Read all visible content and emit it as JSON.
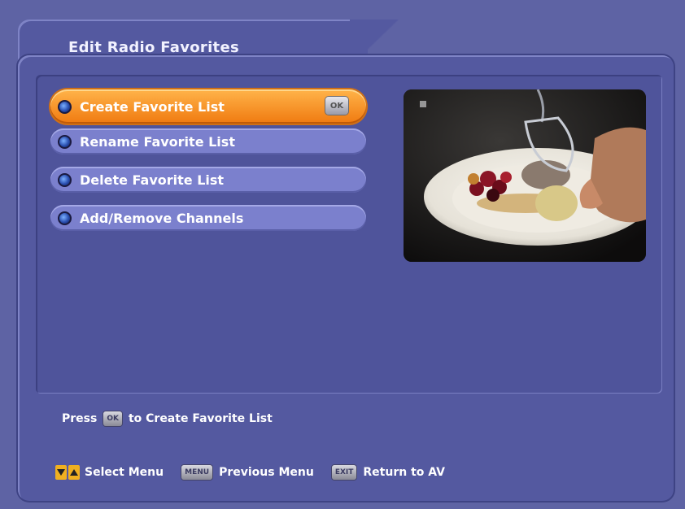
{
  "window": {
    "title": "Edit Radio Favorites"
  },
  "menu": {
    "items": [
      {
        "label": "Create Favorite List",
        "selected": true,
        "badge": "OK"
      },
      {
        "label": "Rename Favorite List",
        "selected": false
      },
      {
        "label": "Delete Favorite List",
        "selected": false
      },
      {
        "label": "Add/Remove Channels",
        "selected": false
      }
    ]
  },
  "hint": {
    "press": "Press",
    "key": "OK",
    "action": "to Create Favorite List"
  },
  "footer": {
    "select_label": "Select Menu",
    "menu_key": "MENU",
    "menu_label": "Previous Menu",
    "exit_key": "EXIT",
    "exit_label": "Return to AV"
  },
  "colors": {
    "background": "#5e63a4",
    "panel": "#5459a0",
    "menu_item": "#7b80cd",
    "selected": "#f07a10",
    "arrow_key": "#f0b020"
  },
  "icons": {
    "bullet": "radio-bullet-icon",
    "arrow_down": "arrow-down-icon",
    "arrow_up": "arrow-up-icon"
  }
}
